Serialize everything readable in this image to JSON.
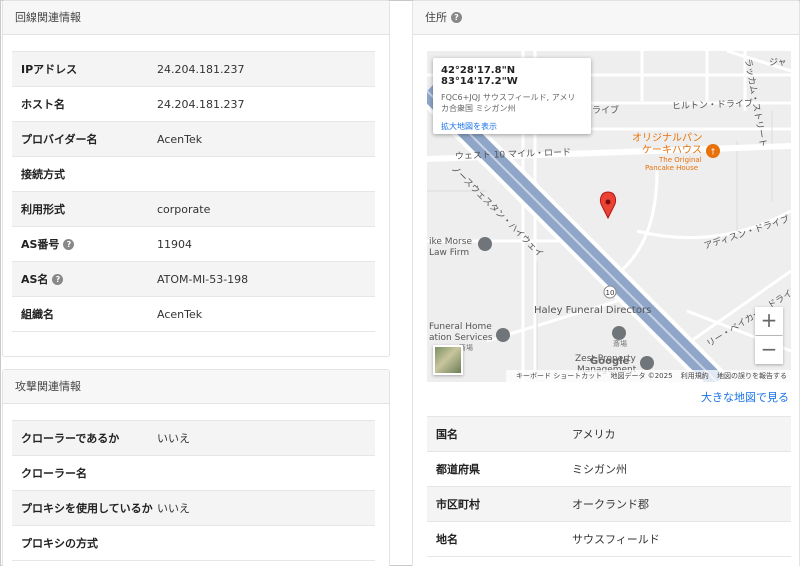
{
  "line_info": {
    "title": "回線関連情報",
    "rows": [
      {
        "label": "IPアドレス",
        "value": "24.204.181.237",
        "help": false
      },
      {
        "label": "ホスト名",
        "value": "24.204.181.237",
        "help": false
      },
      {
        "label": "プロバイダー名",
        "value": "AcenTek",
        "help": false
      },
      {
        "label": "接続方式",
        "value": "",
        "help": false
      },
      {
        "label": "利用形式",
        "value": "corporate",
        "help": false
      },
      {
        "label": "AS番号",
        "value": "11904",
        "help": true
      },
      {
        "label": "AS名",
        "value": "ATOM-MI-53-198",
        "help": true
      },
      {
        "label": "組織名",
        "value": "AcenTek",
        "help": false
      }
    ]
  },
  "attack_info": {
    "title": "攻撃関連情報",
    "rows": [
      {
        "label": "クローラーであるか",
        "value": "いいえ"
      },
      {
        "label": "クローラー名",
        "value": ""
      },
      {
        "label": "プロキシを使用しているか",
        "value": "いいえ"
      },
      {
        "label": "プロキシの方式",
        "value": ""
      }
    ]
  },
  "address": {
    "title": "住所",
    "help_glyph": "?",
    "larger_map_link": "大きな地図で見る",
    "rows": [
      {
        "label": "国名",
        "value": "アメリカ"
      },
      {
        "label": "都道府県",
        "value": "ミシガン州"
      },
      {
        "label": "市区町村",
        "value": "オークランド郡"
      },
      {
        "label": "地名",
        "value": "サウスフィールド"
      }
    ]
  },
  "map": {
    "info_coord": "42°28'17.8\"N 83°14'17.2\"W",
    "info_address": "FQC6+JQJ サウスフィールド, アメリカ合衆国 ミシガン州",
    "info_link": "拡大地図を表示",
    "zoom_in": "+",
    "zoom_out": "−",
    "google_logo": "Google",
    "attribution": [
      "キーボード ショートカット",
      "地図データ ©2025",
      "利用規約",
      "地図の誤りを報告する"
    ],
    "labels": {
      "road_west10": "ウェスト 10 マイル・ロード",
      "highway": "ノースウェスタン・ハイウェイ",
      "hilton": "ヒルトン・ドライブ",
      "drive_partial": "ライブ",
      "vertical_street": "ラッカム・ストリート",
      "top_right": "ジャ",
      "addison": "アディスン・ドライブ",
      "baker": "リー・ベイカー・ドライブ",
      "pancake_jp": "オリジナルパン\nケーキハウス",
      "pancake_en": "The Original\nPancake House",
      "mike_morse": "ike Morse\nLaw Firm",
      "haley": "Haley Funeral Directors",
      "haley_sub": "斎場",
      "funeral_home": "Funeral Home\nation Services",
      "funeral_sub": "斎場",
      "zest": "Zest Property\nManagement",
      "route_shield": "10"
    },
    "colors": {
      "highway": "#8fa6c9",
      "marker": "#ea4335",
      "poi_orange": "#e8710a",
      "poi_gray": "#70757a"
    }
  }
}
